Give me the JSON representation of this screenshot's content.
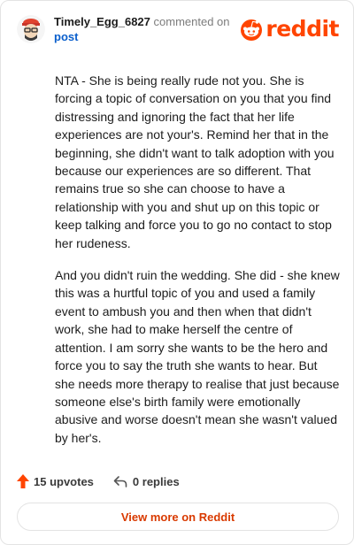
{
  "comment": {
    "username": "Timely_Egg_6827",
    "action_text": "commented on",
    "post_link": "post",
    "paragraphs": [
      "NTA - She is being really rude not you. She is forcing a topic of conversation on you that you find distressing and ignoring the fact that her life experiences are not your's. Remind her that in the beginning, she didn't want to talk adoption with you because our experiences are so different. That remains true so she can choose to have a relationship with you and shut up on this topic or keep talking and force you to go no contact to stop her rudeness.",
      "And you didn't ruin the wedding. She did - she knew this was a hurtful topic of you and used a family event to ambush you and then when that didn't work, she had to make herself the centre of attention. I am sorry she wants to be the hero and force you to say the truth she wants to hear. But she needs more therapy to realise that just because someone else's birth family were emotionally abusive and worse doesn't mean she wasn't valued by her's."
    ],
    "upvotes_text": "15 upvotes",
    "replies_text": "0 replies"
  },
  "brand": {
    "wordmark": "reddit",
    "color": "#ff4500"
  },
  "cta": {
    "view_more_label": "View more on Reddit"
  },
  "icons": {
    "upvote": "upvote-arrow-icon",
    "reply": "reply-arrow-icon",
    "logo": "reddit-snoo-icon"
  }
}
